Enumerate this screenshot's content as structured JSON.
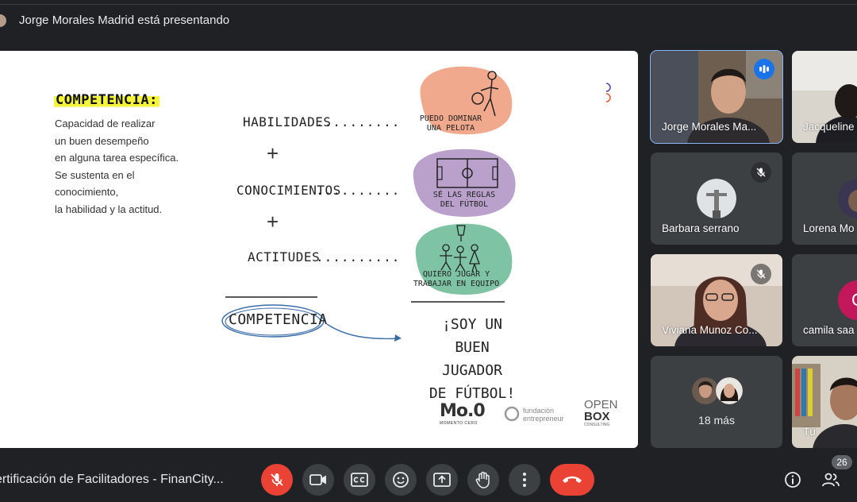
{
  "header": {
    "presenting_text": "Jorge Morales Madrid está presentando"
  },
  "slide": {
    "competencia_title": "COMPETENCIA:",
    "competencia_desc": "Capacidad de realizar\nun buen desempeño\nen alguna tarea específica.\nSe sustenta en el\nconocimiento,\nla habilidad y la actitud.",
    "row1_word": "HABILIDADES",
    "row2_word": "CONOCIMIENTOS",
    "row3_word": "ACTITUDES",
    "dots": "..........",
    "plus": "+",
    "blob1_label": "PUEDO DOMINAR\nUNA PELOTA",
    "blob2_label": "SÉ LAS REGLAS\nDEL FÚTBOL",
    "blob3_label": "QUIERO JUGAR Y\nTRABAJAR EN EQUIPO",
    "competencia_circled": "COMPETENCIA",
    "result_text": "¡SOY UN BUEN\nJUGADOR\nDE FÚTBOL!",
    "logo1_main": "Mo.0",
    "logo1_sub": "MOMENTO CERO",
    "logo2_line1": "fundación",
    "logo2_line2": "entrepreneur",
    "logo3_line1": "OPEN",
    "logo3_line2": "BOX",
    "logo3_line3": "CONSULTING",
    "colors": {
      "blob1": "#f1a98d",
      "blob2": "#b9a1cc",
      "blob3": "#7fc3a5",
      "highlight": "#f4f43a"
    }
  },
  "participants": [
    {
      "name": "Jorge Morales Ma...",
      "speaking": true
    },
    {
      "name": "Jacqueline"
    },
    {
      "name": "Barbara serrano",
      "muted": true
    },
    {
      "name": "Lorena Mo"
    },
    {
      "name": "Viviana Munoz Co...",
      "muted": true
    },
    {
      "name": "camila saa",
      "initial": "C"
    },
    {
      "name": "18 más"
    },
    {
      "name": "Tú"
    }
  ],
  "bottom": {
    "meeting_title": "ertificación de Facilitadores - FinanCity...",
    "participant_count": "26"
  },
  "icons": [
    "mic-off-icon",
    "videocam-icon",
    "captions-icon",
    "emoji-icon",
    "present-icon",
    "raise-hand-icon",
    "more-icon",
    "call-end-icon",
    "info-icon",
    "people-icon"
  ]
}
